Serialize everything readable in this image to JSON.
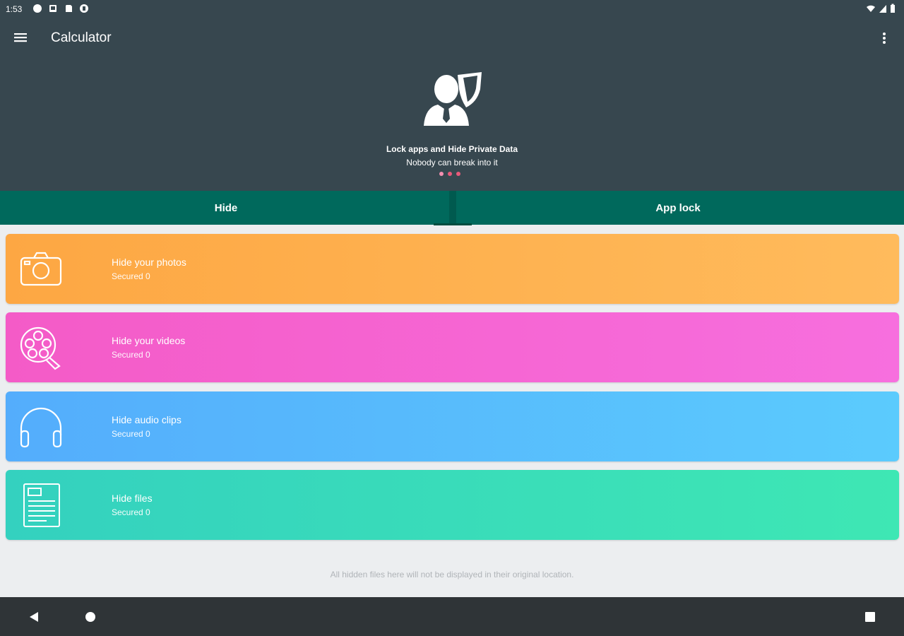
{
  "status_bar": {
    "time": "1:53"
  },
  "app_bar": {
    "title": "Calculator"
  },
  "hero": {
    "title": "Lock apps and Hide Private Data",
    "subtitle": "Nobody can break into it"
  },
  "tabs": [
    {
      "label": "Hide"
    },
    {
      "label": "App lock"
    }
  ],
  "cards": [
    {
      "title": "Hide your photos",
      "subtitle": "Secured 0",
      "icon": "camera-icon"
    },
    {
      "title": "Hide your videos",
      "subtitle": "Secured 0",
      "icon": "film-reel-icon"
    },
    {
      "title": "Hide audio clips",
      "subtitle": "Secured 0",
      "icon": "headphones-icon"
    },
    {
      "title": "Hide files",
      "subtitle": "Secured 0",
      "icon": "document-icon"
    }
  ],
  "footer_note": "All hidden files here will not be displayed in their original location.",
  "colors": {
    "header_bg": "#37474f",
    "tab_bg": "#00695c",
    "photos_card": "#fda743",
    "videos_card": "#f45bc7",
    "audio_card": "#54adfc",
    "files_card": "#34d1bf",
    "dot_accent": "#e85a7a"
  }
}
